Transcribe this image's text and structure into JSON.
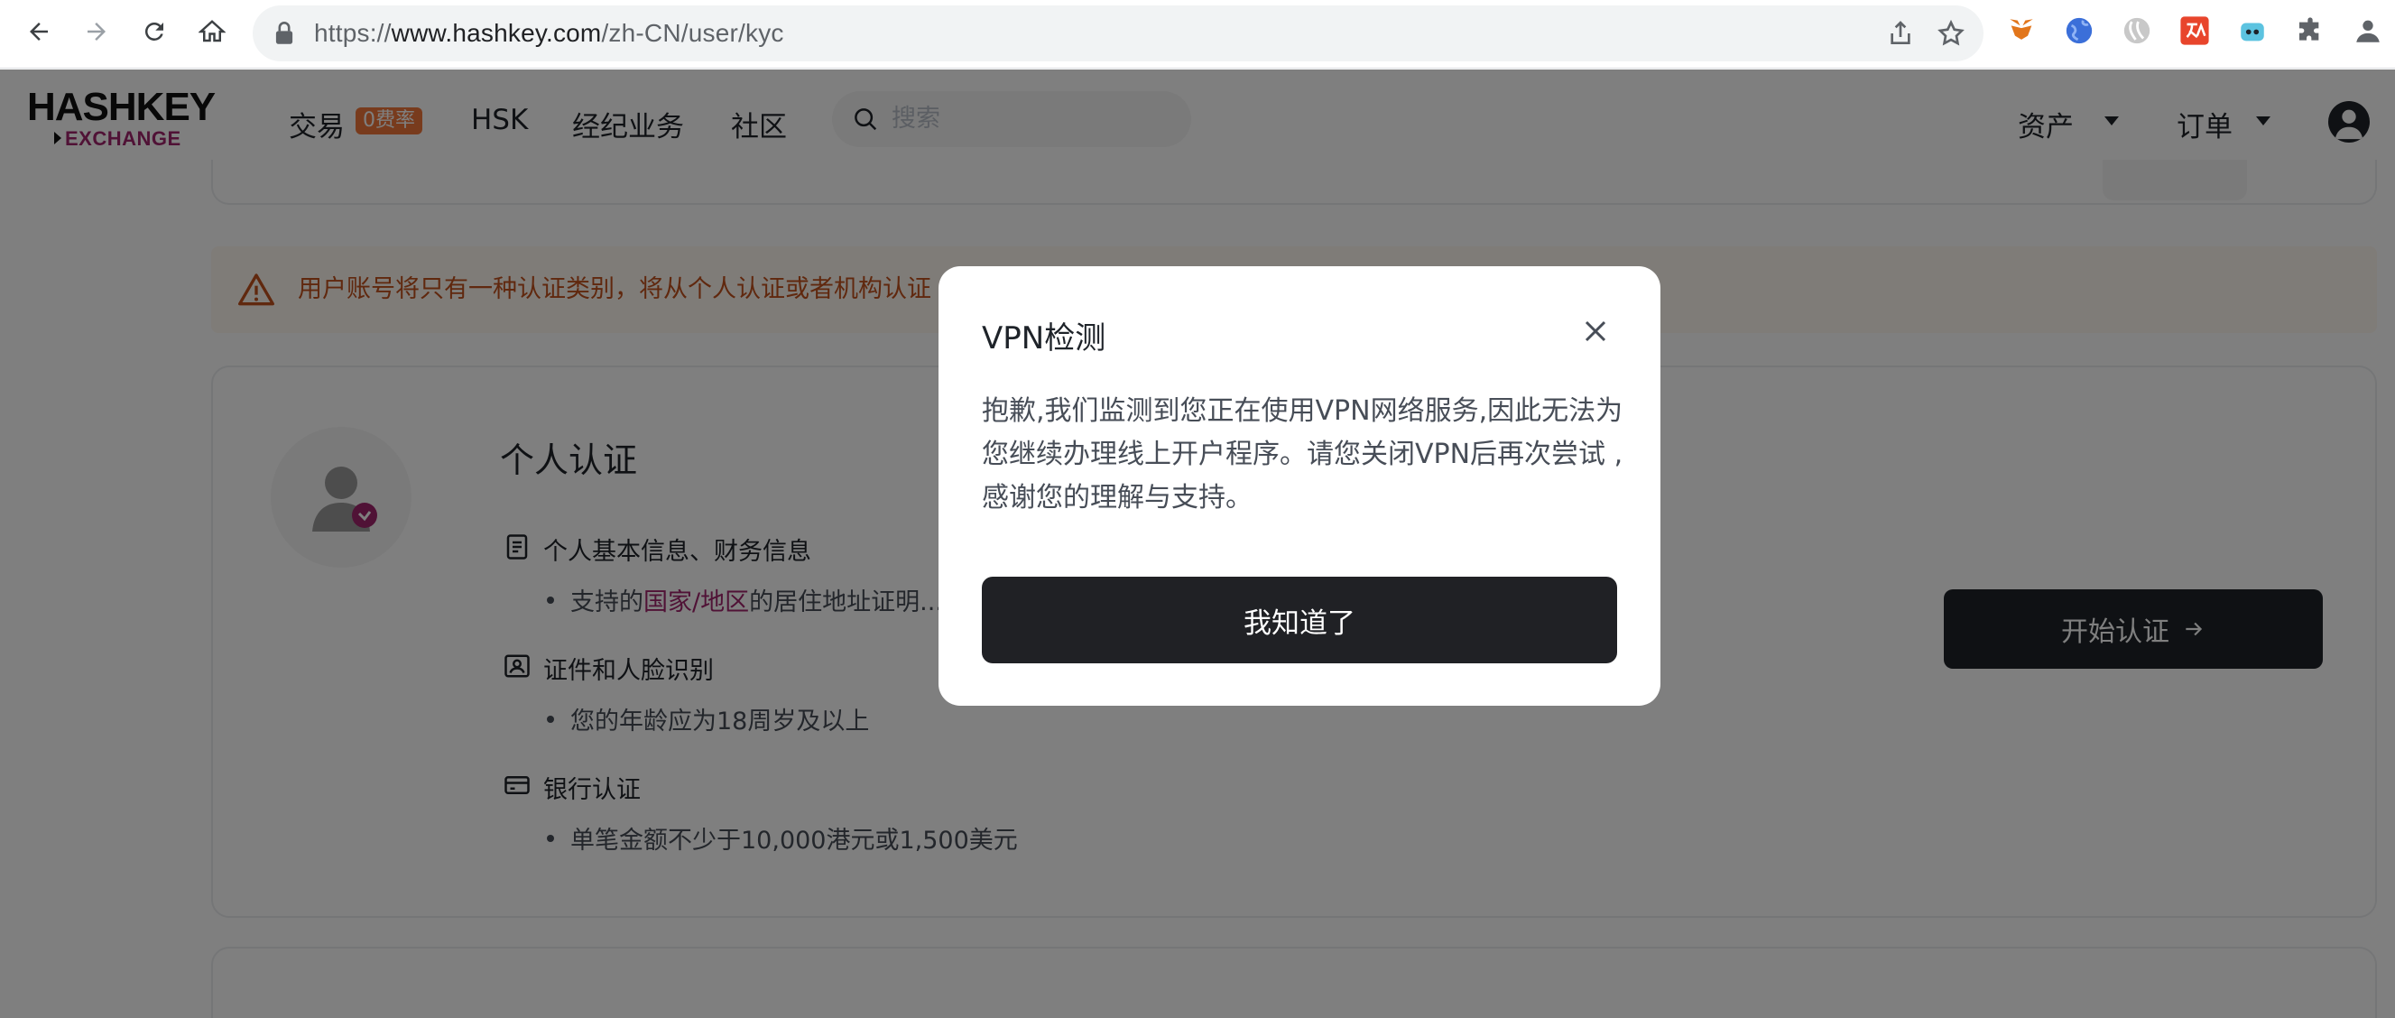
{
  "browser": {
    "url_prefix": "https://",
    "url_domain": "www.hashkey.com",
    "url_path": "/zh-CN/user/kyc",
    "extensions": [
      "metamask-icon",
      "globe-icon",
      "swirl-icon",
      "translate-icon",
      "robot-icon",
      "puzzle-icon",
      "profile-icon"
    ]
  },
  "header": {
    "logo_top": "HASHKEY",
    "logo_bottom": "EXCHANGE",
    "nav": {
      "trade": "交易",
      "trade_badge": "0费率",
      "hsk": "HSK",
      "brokerage": "经纪业务",
      "community": "社区"
    },
    "search_placeholder": "搜索",
    "assets": "资产",
    "orders": "订单"
  },
  "alert": {
    "text": "用户账号将只有一种认证类别，将从个人认证或者机构认证"
  },
  "kyc": {
    "title": "个人认证",
    "sections": [
      {
        "label": "个人基本信息、财务信息",
        "bullet_pre": "支持的",
        "bullet_link": "国家/地区",
        "bullet_post": "的居住地址证明..."
      },
      {
        "label": "证件和人脸识别",
        "bullet": "您的年龄应为18周岁及以上"
      },
      {
        "label": "银行认证",
        "bullet": "单笔金额不少于10,000港元或1,500美元"
      }
    ],
    "start_button": "开始认证"
  },
  "modal": {
    "title": "VPN检测",
    "body": "抱歉,我们监测到您正在使用VPN网络服务,因此无法为您继续办理线上开户程序。请您关闭VPN后再次尝试 ,感谢您的理解与支持。",
    "confirm": "我知道了"
  },
  "colors": {
    "brand_magenta": "#a0246c",
    "badge_orange": "#f0773a",
    "alert_text": "#c1501d",
    "button_dark": "#202125"
  }
}
